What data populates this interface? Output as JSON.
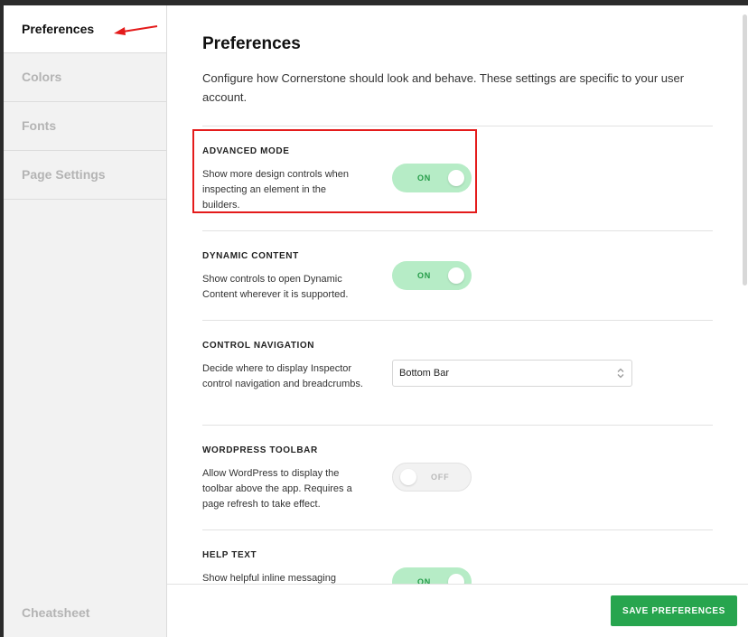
{
  "sidebar": {
    "items": [
      {
        "label": "Preferences",
        "active": true
      },
      {
        "label": "Colors",
        "active": false
      },
      {
        "label": "Fonts",
        "active": false
      },
      {
        "label": "Page Settings",
        "active": false
      }
    ],
    "footer_label": "Cheatsheet"
  },
  "main": {
    "title": "Preferences",
    "description": "Configure how Cornerstone should look and behave. These settings are specific to your user account.",
    "sections": [
      {
        "label": "ADVANCED MODE",
        "description": "Show more design controls when inspecting an element in the builders.",
        "control": "toggle",
        "state": "ON"
      },
      {
        "label": "DYNAMIC CONTENT",
        "description": "Show controls to open Dynamic Content wherever it is supported.",
        "control": "toggle",
        "state": "ON"
      },
      {
        "label": "CONTROL NAVIGATION",
        "description": "Decide where to display Inspector control navigation and breadcrumbs.",
        "control": "select",
        "value": "Bottom Bar"
      },
      {
        "label": "WORDPRESS TOOLBAR",
        "description": "Allow WordPress to display the toolbar above the app. Requires a page refresh to take effect.",
        "control": "toggle",
        "state": "OFF"
      },
      {
        "label": "HELP TEXT",
        "description": "Show helpful inline messaging",
        "control": "toggle",
        "state": "ON"
      }
    ]
  },
  "footer": {
    "save_label": "SAVE PREFERENCES"
  },
  "colors": {
    "accent_green": "#27a54e",
    "toggle_on_bg": "#b6ecc6",
    "highlight_red": "#e41b1b"
  },
  "icons": [
    "arrow-annotation-icon",
    "select-caret-icon"
  ]
}
